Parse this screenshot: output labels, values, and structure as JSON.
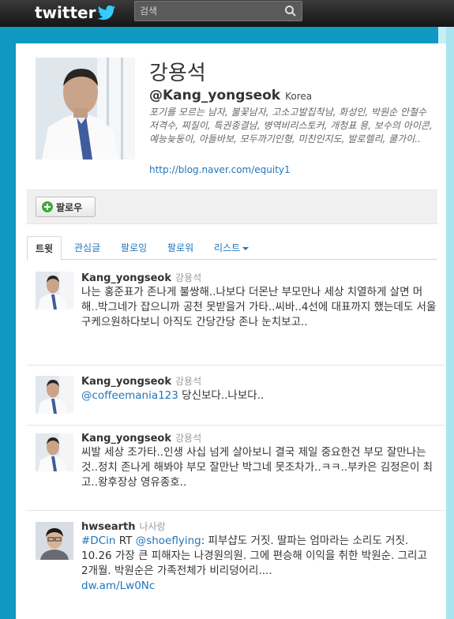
{
  "topbar": {
    "logo_text": "twitter",
    "search_placeholder": "검색"
  },
  "profile": {
    "name": "강용석",
    "handle": "@Kang_yongseok",
    "location": "Korea",
    "bio": "포기를 모르는 남자, 불꽃남자, 고소고발집착남, 화성인, 박원순 안철수 저격수, 찌질이, 특권종결남, 병역비리스토커, 개청표 용, 보수의 아이콘, 예능늦둥이, 아들바보, 모두까기인형, 미친인지도, 발로렐리, 쿨가이..",
    "url": "http://blog.naver.com/equity1"
  },
  "actions": {
    "follow_label": "팔로우"
  },
  "tabs": [
    "트윗",
    "관심글",
    "팔로잉",
    "팔로워",
    "리스트"
  ],
  "tweets": [
    {
      "user": "Kang_yongseok",
      "realname": "강용석",
      "text": "나는 홍준표가 존나게 불쌍해..나보다 더몬난 부모만나 세상 치열하게 살면 머해..박그네가 잡으니까 공천 못받을거 가타..씨바..4선에 대표까지 했는데도 서울 구케으원하다보니 아직도 간당간당 존나 눈치보고.."
    },
    {
      "user": "Kang_yongseok",
      "realname": "강용석",
      "mention": "@coffeemania123",
      "text": " 당신보다..나보다.."
    },
    {
      "user": "Kang_yongseok",
      "realname": "강용석",
      "text": "씨발 세상 조가타..인생 사십 넘게 살아보니 결국 제일 중요한건 부모 잘만나는것..정치 존나게 해봐야 부모 잘만난 박그네 못조차가..ㅋㅋ..부카은 김정은이 최고..왕후장상 영유종호.."
    },
    {
      "user": "hwsearth",
      "realname": "나사랑",
      "hashtag": "#DCin",
      "rt": " RT ",
      "mention": "@shoeflying",
      "text": ": 피부샵도 거짓. 딸파는 엄마라는 소리도 거짓. 10.26 가장 큰 피해자는 나경원의원. 그에 편승해 이익을 취한 박원순. 그리고 2개월. 박원순은 가족전체가 비리덩어리....",
      "link": "dw.am/Lw0Nc"
    }
  ]
}
